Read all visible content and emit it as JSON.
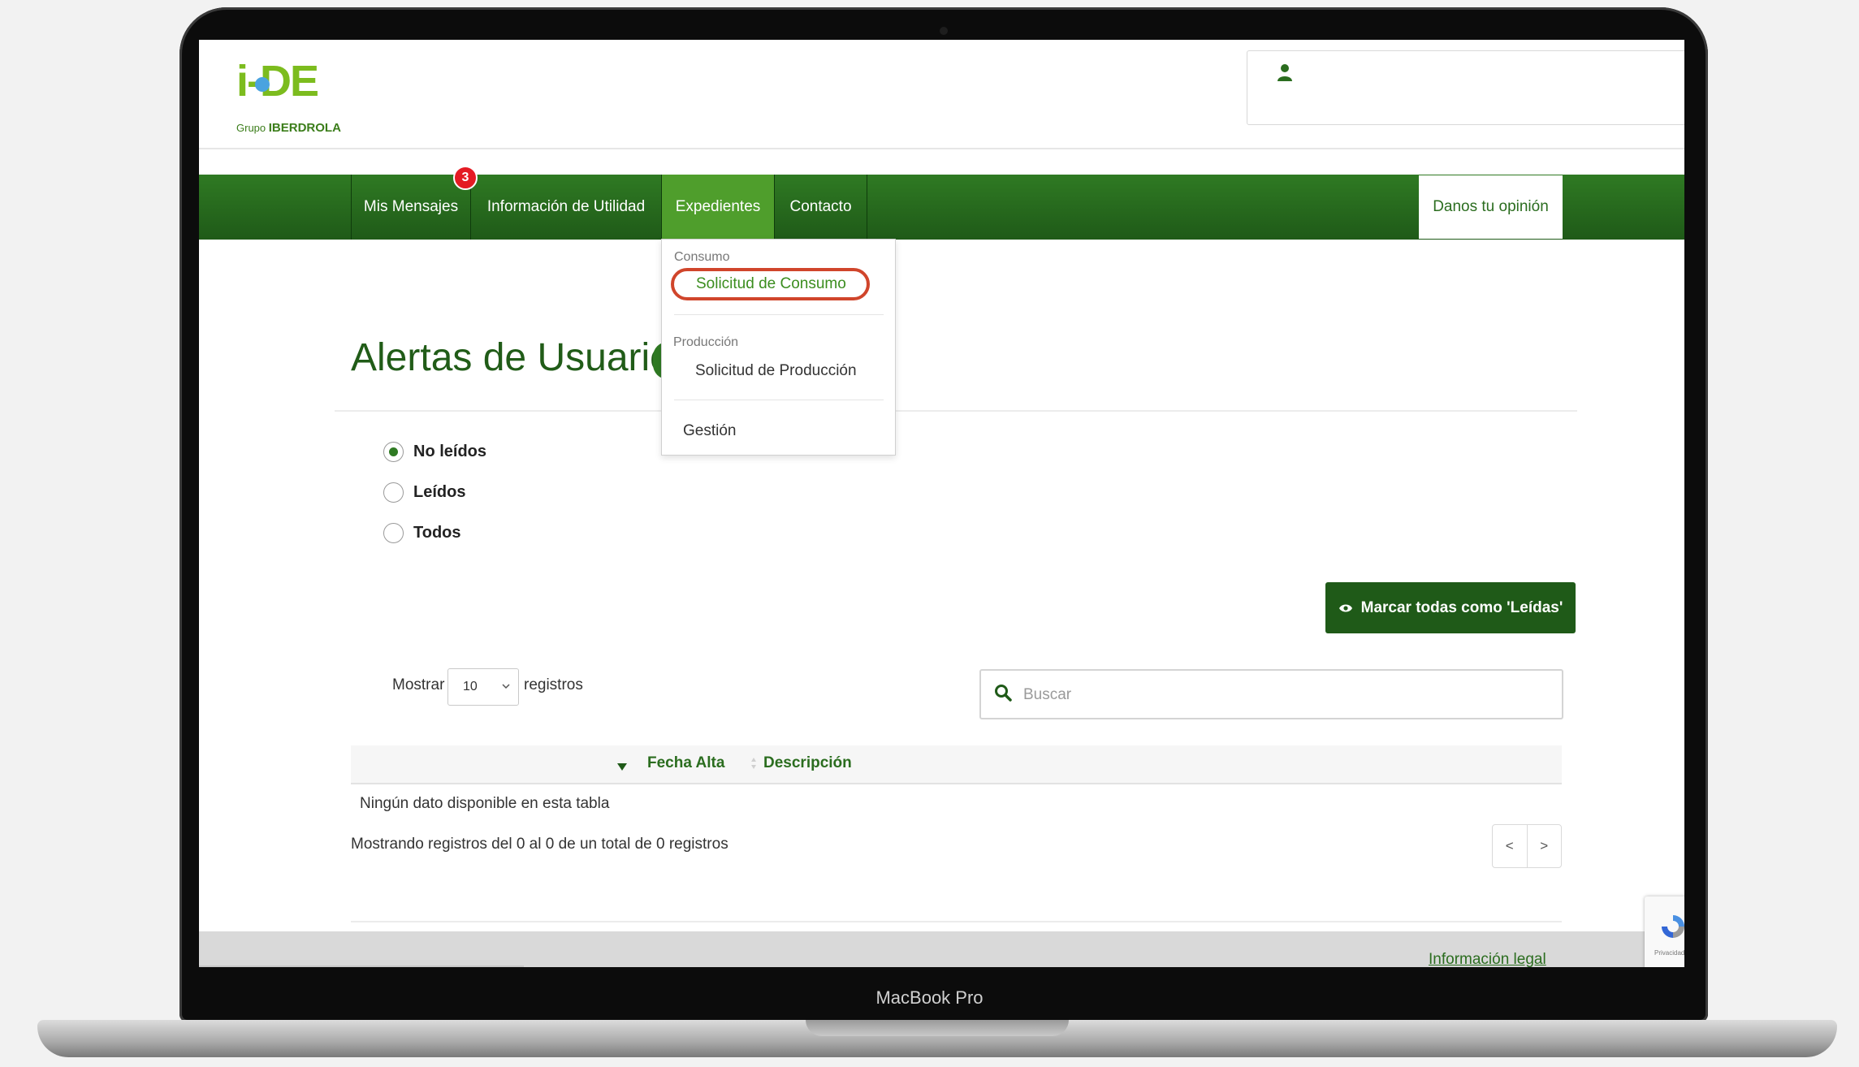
{
  "device": {
    "brand": "MacBook Pro"
  },
  "logo": {
    "main": "i-DE",
    "sub_prefix": "Grupo",
    "sub_brand": "IBERDROLA"
  },
  "nav": {
    "items": [
      {
        "label": "Mis Mensajes"
      },
      {
        "label": "Información de Utilidad"
      },
      {
        "label": "Expedientes"
      },
      {
        "label": "Contacto"
      }
    ],
    "badge": "3",
    "opinion": "Danos tu opinión"
  },
  "dropdown": {
    "section1": "Consumo",
    "item1": "Solicitud de Consumo",
    "section2": "Producción",
    "item2": "Solicitud de Producción",
    "item3": "Gestión"
  },
  "page": {
    "title": "Alertas de Usuario"
  },
  "filters": [
    {
      "label": "No leídos",
      "selected": true
    },
    {
      "label": "Leídos",
      "selected": false
    },
    {
      "label": "Todos",
      "selected": false
    }
  ],
  "mark_all_button": "Marcar todas como 'Leídas'",
  "table": {
    "length_prefix": "Mostrar",
    "length_value": "10",
    "length_suffix": "registros",
    "search_placeholder": "Buscar",
    "columns": [
      "Fecha Alta",
      "Descripción"
    ],
    "empty": "Ningún dato disponible en esta tabla",
    "info": "Mostrando registros del 0 al 0 de un total de 0 registros",
    "pager_prev": "<",
    "pager_next": ">"
  },
  "footer": {
    "legal": "Información legal"
  },
  "recaptcha": {
    "text": "Privacidad"
  },
  "colors": {
    "primary_green": "#1f5a18",
    "accent_green": "#4f9e2c",
    "badge_red": "#e41b23",
    "highlight": "#d0452b"
  }
}
